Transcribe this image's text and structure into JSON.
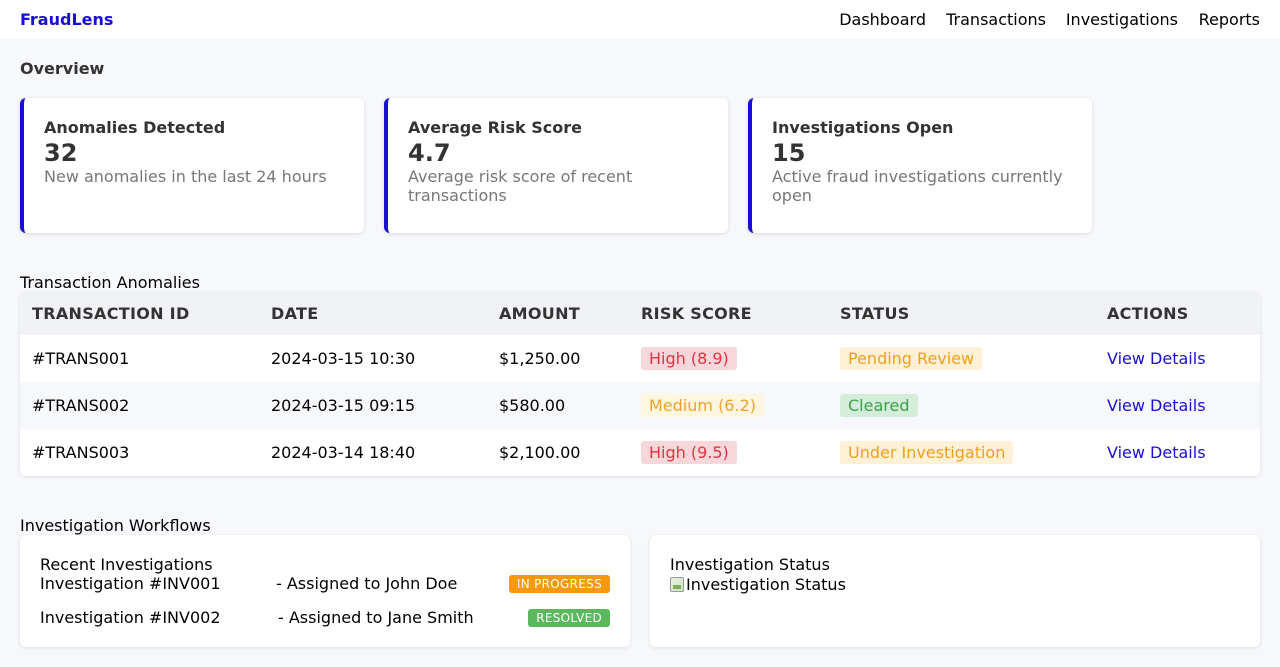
{
  "nav": {
    "brand": "FraudLens",
    "links": [
      "Dashboard",
      "Transactions",
      "Investigations",
      "Reports"
    ]
  },
  "overview": {
    "title": "Overview",
    "cards": [
      {
        "title": "Anomalies Detected",
        "value": "32",
        "desc": "New anomalies in the last 24 hours"
      },
      {
        "title": "Average Risk Score",
        "value": "4.7",
        "desc": "Average risk score of recent transactions"
      },
      {
        "title": "Investigations Open",
        "value": "15",
        "desc": "Active fraud investigations currently open"
      }
    ]
  },
  "anomalies": {
    "title": "Transaction Anomalies",
    "columns": [
      "TRANSACTION ID",
      "DATE",
      "AMOUNT",
      "RISK SCORE",
      "STATUS",
      "ACTIONS"
    ],
    "rows": [
      {
        "id": "#TRANS001",
        "date": "2024-03-15 10:30",
        "amount": "$1,250.00",
        "risk": "High (8.9)",
        "status": "Pending Review",
        "action": "View Details"
      },
      {
        "id": "#TRANS002",
        "date": "2024-03-15 09:15",
        "amount": "$580.00",
        "risk": "Medium (6.2)",
        "status": "Cleared",
        "action": "View Details"
      },
      {
        "id": "#TRANS003",
        "date": "2024-03-14 18:40",
        "amount": "$2,100.00",
        "risk": "High (9.5)",
        "status": "Under Investigation",
        "action": "View Details"
      }
    ]
  },
  "workflows": {
    "title": "Investigation Workflows",
    "recent_title": "Recent Investigations",
    "items": [
      {
        "name": "Investigation #INV001",
        "assigned": "- Assigned to John Doe",
        "badge": "IN PROGRESS"
      },
      {
        "name": "Investigation #INV002",
        "assigned": "- Assigned to Jane Smith",
        "badge": "RESOLVED"
      }
    ],
    "status_title": "Investigation Status",
    "status_image_alt": "Investigation Status"
  },
  "colors": {
    "accent": "#1a0dd8",
    "high_bg": "#f8d7da",
    "high_fg": "#dc3545",
    "medium_bg": "#fff6e0",
    "medium_fg": "#f0a32c",
    "cleared_bg": "#d4edda",
    "cleared_fg": "#3ea04c",
    "in_progress": "#f7990d",
    "resolved": "#5cb85c"
  }
}
